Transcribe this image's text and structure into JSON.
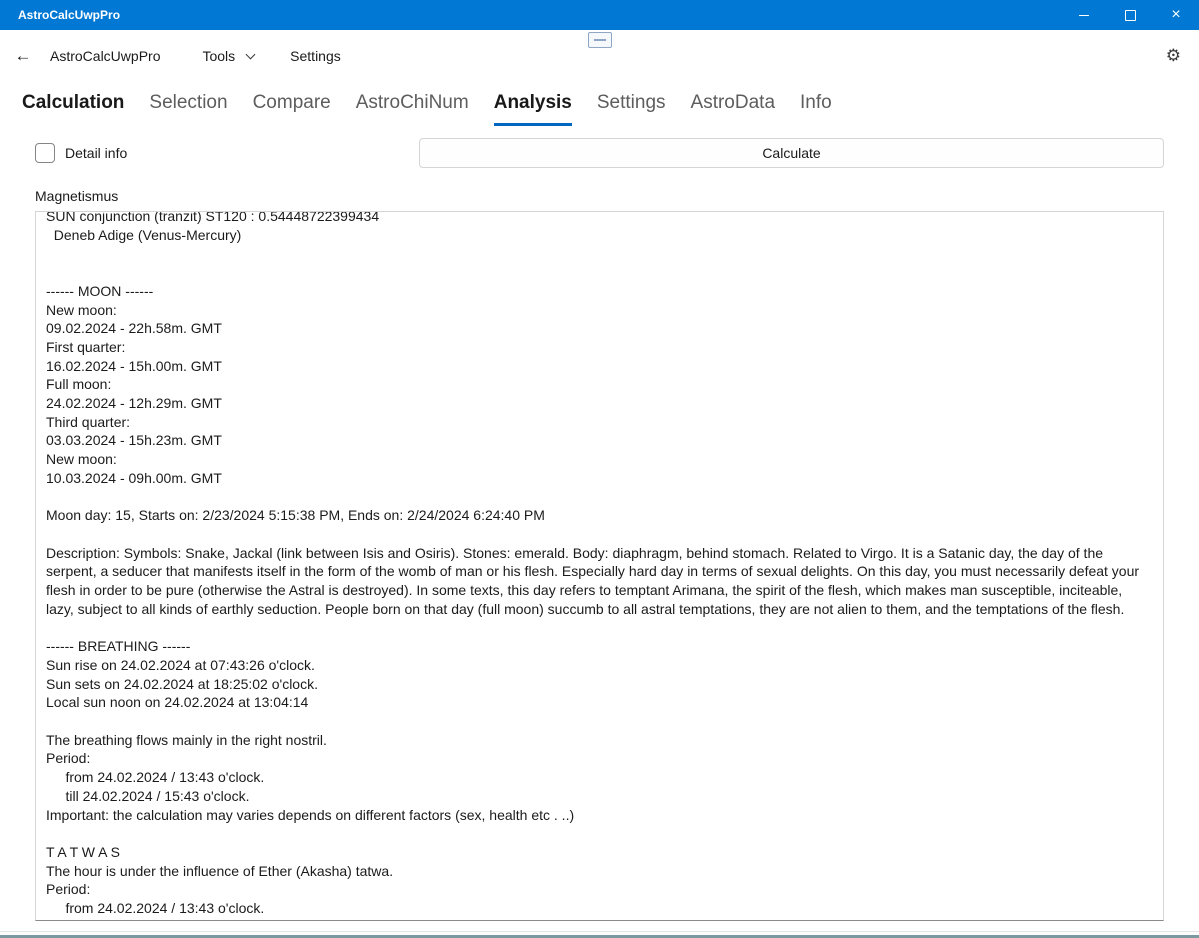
{
  "titlebar": {
    "title": "AstroCalcUwpPro"
  },
  "navbar": {
    "app_name": "AstroCalcUwpPro",
    "tools_label": "Tools",
    "settings_label": "Settings"
  },
  "icons": {
    "back_arrow": "←",
    "chevron_down": "css-chevron",
    "gear": "⚙",
    "minimize": "css-line",
    "maximize": "css-square",
    "close": "×",
    "touch_keyboard": "css-keyboard"
  },
  "tabs": [
    {
      "label": "Calculation",
      "selected": false
    },
    {
      "label": "Selection",
      "selected": false
    },
    {
      "label": "Compare",
      "selected": false
    },
    {
      "label": "AstroChiNum",
      "selected": false
    },
    {
      "label": "Analysis",
      "selected": true
    },
    {
      "label": "Settings",
      "selected": false
    },
    {
      "label": "AstroData",
      "selected": false
    },
    {
      "label": "Info",
      "selected": false
    }
  ],
  "controls": {
    "detail_info_label": "Detail info",
    "detail_info_checked": false,
    "calculate_label": "Calculate"
  },
  "colors": {
    "titlebar_bg": "#0078d4",
    "tab_underline": "#0067c0",
    "scrollbar_accent": "#7a98a0"
  },
  "output": {
    "section_label": "Magnetismus",
    "text": "SUN conjunction (tranzit) ST120 : 0.54448722399434\n  Deneb Adige (Venus-Mercury)\n\n\n------ MOON ------\nNew moon:\n09.02.2024 - 22h.58m. GMT\nFirst quarter:\n16.02.2024 - 15h.00m. GMT\nFull moon:\n24.02.2024 - 12h.29m. GMT\nThird quarter:\n03.03.2024 - 15h.23m. GMT\nNew moon:\n10.03.2024 - 09h.00m. GMT\n\nMoon day: 15, Starts on: 2/23/2024 5:15:38 PM, Ends on: 2/24/2024 6:24:40 PM\n\nDescription: Symbols: Snake, Jackal (link between Isis and Osiris). Stones: emerald. Body: diaphragm, behind stomach. Related to Virgo. It is a Satanic day, the day of the serpent, a seducer that manifests itself in the form of the womb of man or his flesh. Especially hard day in terms of sexual delights. On this day, you must necessarily defeat your flesh in order to be pure (otherwise the Astral is destroyed). In some texts, this day refers to temptant Arimana, the spirit of the flesh, which makes man susceptible, inciteable, lazy, subject to all kinds of earthly seduction. People born on that day (full moon) succumb to all astral temptations, they are not alien to them, and the temptations of the flesh.\n\n------ BREATHING ------\nSun rise on 24.02.2024 at 07:43:26 o'clock.\nSun sets on 24.02.2024 at 18:25:02 o'clock.\nLocal sun noon on 24.02.2024 at 13:04:14\n\nThe breathing flows mainly in the right nostril.\nPeriod:\n     from 24.02.2024 / 13:43 o'clock.\n     till 24.02.2024 / 15:43 o'clock.\nImportant: the calculation may varies depends on different factors (sex, health etc . ..)\n\nT A T W A S\nThe hour is under the influence of Ether (Akasha) tatwa.\nPeriod:\n     from 24.02.2024 / 13:43 o'clock."
  }
}
